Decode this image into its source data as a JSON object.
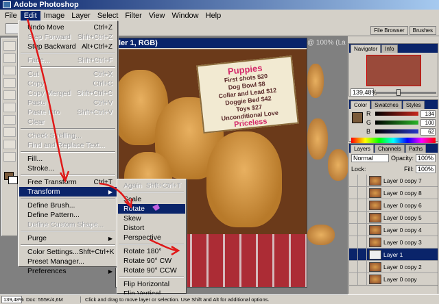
{
  "app": {
    "title": "Adobe Photoshop"
  },
  "menubar": [
    "File",
    "Edit",
    "Image",
    "Layer",
    "Select",
    "Filter",
    "View",
    "Window",
    "Help"
  ],
  "palette_well": [
    "File Browser",
    "Brushes"
  ],
  "document": {
    "title": "ler 1, RGB)",
    "bg_title": "@ 100% (La"
  },
  "sign": {
    "title": "Puppies",
    "lines": [
      "First shots $20",
      "Dog Bowl $8",
      "Collar and Lead $12",
      "Doggie Bed $42",
      "Toys $27",
      "Unconditional Love",
      "Priceless"
    ]
  },
  "edit_menu": [
    {
      "label": "Undo Move",
      "shortcut": "Ctrl+Z",
      "state": "enabled"
    },
    {
      "label": "Step Forward",
      "shortcut": "Shft+Ctrl+Z",
      "state": "disabled"
    },
    {
      "label": "Step Backward",
      "shortcut": "Alt+Ctrl+Z",
      "state": "enabled"
    },
    {
      "sep": true
    },
    {
      "label": "Fade...",
      "shortcut": "Shft+Ctrl+F",
      "state": "disabled"
    },
    {
      "sep": true
    },
    {
      "label": "Cut",
      "shortcut": "Ctrl+X",
      "state": "disabled"
    },
    {
      "label": "Copy",
      "shortcut": "Ctrl+C",
      "state": "disabled"
    },
    {
      "label": "Copy Merged",
      "shortcut": "Shft+Ctrl+C",
      "state": "disabled"
    },
    {
      "label": "Paste",
      "shortcut": "Ctrl+V",
      "state": "disabled"
    },
    {
      "label": "Paste Into",
      "shortcut": "Shft+Ctrl+V",
      "state": "disabled"
    },
    {
      "label": "Clear",
      "shortcut": "",
      "state": "disabled"
    },
    {
      "sep": true
    },
    {
      "label": "Check Spelling...",
      "shortcut": "",
      "state": "disabled"
    },
    {
      "label": "Find and Replace Text...",
      "shortcut": "",
      "state": "disabled"
    },
    {
      "sep": true
    },
    {
      "label": "Fill...",
      "shortcut": "",
      "state": "enabled"
    },
    {
      "label": "Stroke...",
      "shortcut": "",
      "state": "enabled"
    },
    {
      "sep": true
    },
    {
      "label": "Free Transform",
      "shortcut": "Ctrl+T",
      "state": "enabled"
    },
    {
      "label": "Transform",
      "shortcut": "",
      "state": "highlight",
      "submenu": true
    },
    {
      "sep": true
    },
    {
      "label": "Define Brush...",
      "shortcut": "",
      "state": "enabled"
    },
    {
      "label": "Define Pattern...",
      "shortcut": "",
      "state": "enabled"
    },
    {
      "label": "Define Custom Shape...",
      "shortcut": "",
      "state": "disabled"
    },
    {
      "sep": true
    },
    {
      "label": "Purge",
      "shortcut": "",
      "state": "enabled",
      "submenu": true
    },
    {
      "sep": true
    },
    {
      "label": "Color Settings...",
      "shortcut": "Shft+Ctrl+K",
      "state": "enabled"
    },
    {
      "label": "Preset Manager...",
      "shortcut": "",
      "state": "enabled"
    },
    {
      "label": "Preferences",
      "shortcut": "",
      "state": "enabled",
      "submenu": true
    }
  ],
  "transform_menu": [
    {
      "label": "Again",
      "shortcut": "Shft+Ctrl+T",
      "state": "disabled"
    },
    {
      "sep": true
    },
    {
      "label": "Scale",
      "state": "enabled"
    },
    {
      "label": "Rotate",
      "state": "highlight"
    },
    {
      "label": "Skew",
      "state": "enabled"
    },
    {
      "label": "Distort",
      "state": "enabled"
    },
    {
      "label": "Perspective",
      "state": "enabled"
    },
    {
      "sep": true
    },
    {
      "label": "Rotate 180°",
      "state": "enabled"
    },
    {
      "label": "Rotate 90° CW",
      "state": "enabled"
    },
    {
      "label": "Rotate 90° CCW",
      "state": "enabled"
    },
    {
      "sep": true
    },
    {
      "label": "Flip Horizontal",
      "state": "enabled"
    },
    {
      "label": "Flip Vertical",
      "state": "enabled"
    }
  ],
  "navigator": {
    "tabs": [
      "Navigator",
      "Info"
    ],
    "zoom": "139,48%"
  },
  "color_palette": {
    "tabs": [
      "Color",
      "Swatches",
      "Styles"
    ],
    "channels": [
      {
        "label": "R",
        "value": "134",
        "color": "#c8281e"
      },
      {
        "label": "G",
        "value": "100",
        "color": "#28b428"
      },
      {
        "label": "B",
        "value": "62",
        "color": "#2838c8"
      }
    ],
    "swatch_color": "#7a5a3a"
  },
  "layers": {
    "tabs": [
      "Layers",
      "Channels",
      "Paths"
    ],
    "blend_mode": "Normal",
    "opacity_label": "Opacity:",
    "opacity": "100%",
    "lock_label": "Lock:",
    "fill_label": "Fill:",
    "fill": "100%",
    "rows": [
      {
        "name": "Layer 0 copy 7",
        "selected": false
      },
      {
        "name": "Layer 0 copy 8",
        "selected": false
      },
      {
        "name": "Layer 0 copy 6",
        "selected": false
      },
      {
        "name": "Layer 0 copy 5",
        "selected": false
      },
      {
        "name": "Layer 0 copy 4",
        "selected": false
      },
      {
        "name": "Layer 0 copy 3",
        "selected": false
      },
      {
        "name": "Layer 1",
        "selected": true
      },
      {
        "name": "Layer 0 copy 2",
        "selected": false
      },
      {
        "name": "Layer 0 copy",
        "selected": false
      }
    ]
  },
  "status": {
    "zoom": "139,48%",
    "doc": "Doc: 555K/4,6M",
    "hint": "Click and drag to move layer or selection. Use Shift and Alt for additional options."
  }
}
